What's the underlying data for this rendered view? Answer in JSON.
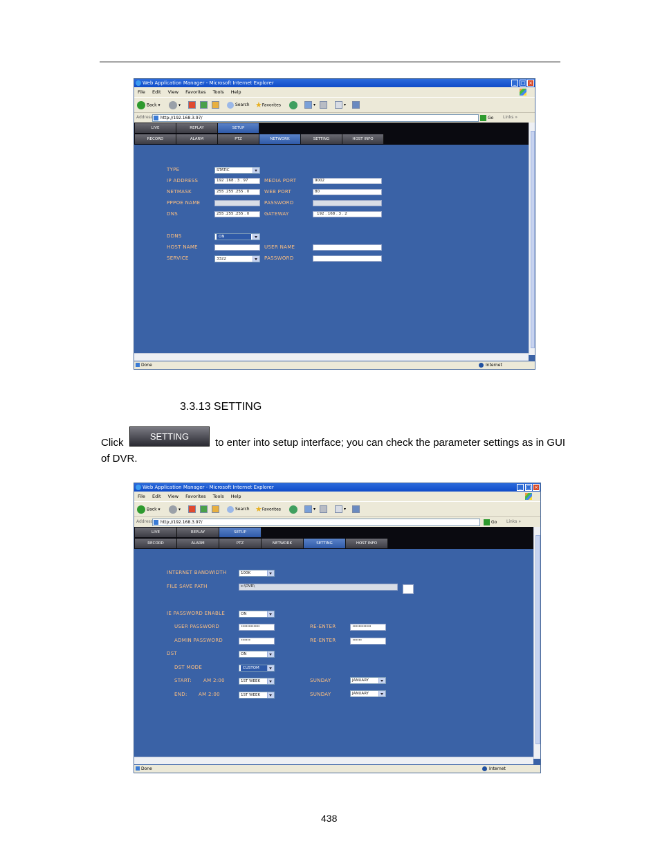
{
  "browser": {
    "title": "Web Application Manager - Microsoft Internet Explorer",
    "menu": [
      "File",
      "Edit",
      "View",
      "Favorites",
      "Tools",
      "Help"
    ],
    "toolbar": {
      "back": "Back",
      "search": "Search",
      "favorites": "Favorites"
    },
    "address_label": "Address",
    "address_url": "http://192.168.3.97/",
    "go": "Go",
    "links": "Links",
    "status_done": "Done",
    "status_zone": "Internet"
  },
  "nav": {
    "top": [
      "LIVE",
      "REPLAY",
      "SETUP"
    ],
    "sub": [
      "RECORD",
      "ALARM",
      "PTZ",
      "NETWORK",
      "SETTING",
      "HOST INFO"
    ]
  },
  "network": {
    "type_label": "TYPE",
    "type_value": "STATIC",
    "ip_label": "IP ADDRESS",
    "ip_value": "192 .168 . 3 . 97",
    "netmask_label": "NETMASK",
    "netmask_value": "255 .255 .255 . 0",
    "pppoe_label": "PPPOE NAME",
    "pppoe_value": "",
    "dns_label": "DNS",
    "dns_value": "255 .255 .255 . 0",
    "media_port_label": "MEDIA PORT",
    "media_port_value": "9002",
    "web_port_label": "WEB PORT",
    "web_port_value": "80",
    "password_label": "PASSWORD",
    "password_value": "",
    "gateway_label": "GATEWAY",
    "gateway_value": "192 . 168 . 3 . 2",
    "ddns_label": "DDNS",
    "ddns_value": "ON",
    "host_name_label": "HOST NAME",
    "host_name_value": "",
    "service_label": "SERVICE",
    "service_value": "3322",
    "user_name_label": "USER NAME",
    "user_name_value": "",
    "ddns_password_label": "PASSWORD",
    "ddns_password_value": ""
  },
  "doc": {
    "section": "3.3.13 SETTING",
    "click": "Click",
    "button_label": "SETTING",
    "after_button": "to enter into setup interface; you can check the parameter settings as in GUI",
    "line2": "of DVR.",
    "page_number": "438"
  },
  "setting": {
    "bandwidth_label": "INTERNET BANDWIDTH",
    "bandwidth_value": "100K",
    "path_label": "FILE SAVE PATH",
    "path_value": "c:\\DVR\\",
    "ie_pwd_label": "IE PASSWORD ENABLE",
    "ie_pwd_value": "ON",
    "user_pwd_label": "USER PASSWORD",
    "user_pwd_value": "••••••••••••",
    "admin_pwd_label": "ADMIN PASSWORD",
    "admin_pwd_value": "••••••",
    "reenter1_label": "RE-ENTER",
    "reenter1_value": "••••••••••••",
    "reenter2_label": "RE-ENTER",
    "reenter2_value": "••••••",
    "dst_label": "DST",
    "dst_value": "ON",
    "dst_mode_label": "DST MODE",
    "dst_mode_value": "CUSTOM",
    "start_label": "START:",
    "start_time": "AM 2:00",
    "start_week": "1ST WEEK",
    "start_day": "SUNDAY",
    "start_month": "JANUARY",
    "end_label": "END:",
    "end_time": "AM 2:00",
    "end_week": "1ST WEEK",
    "end_day": "SUNDAY",
    "end_month": "JANUARY"
  }
}
